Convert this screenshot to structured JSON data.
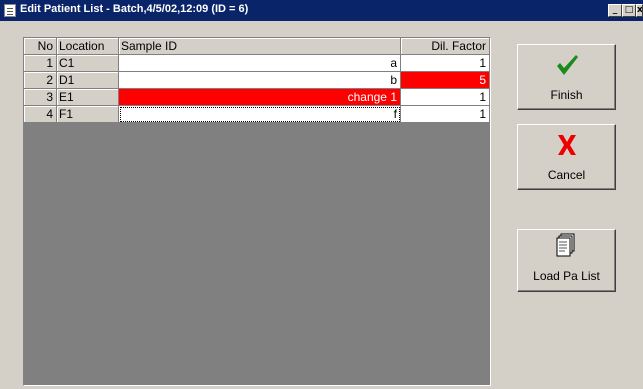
{
  "window": {
    "title": "Edit Patient List - Batch,4/5/02,12:09 (ID = 6)",
    "controls": [
      "_",
      "□",
      "x"
    ]
  },
  "table": {
    "headers": {
      "no": "No",
      "location": "Location",
      "sample_id": "Sample ID",
      "dil_factor": "Dil. Factor"
    },
    "rows": [
      {
        "no": "1",
        "location": "C1",
        "sample_id": "a",
        "dil_factor": "1"
      },
      {
        "no": "2",
        "location": "D1",
        "sample_id": "b",
        "dil_factor": "5"
      },
      {
        "no": "3",
        "location": "E1",
        "sample_id": "change 1",
        "dil_factor": "1"
      },
      {
        "no": "4",
        "location": "F1",
        "sample_id": "f",
        "dil_factor": "1"
      }
    ],
    "highlight_color": "#ff0000"
  },
  "actions": {
    "finish_label": "Finish",
    "cancel_label": "Cancel",
    "load_label": "Load Pa List",
    "finish_icon": "checkmark-icon",
    "cancel_icon": "x-icon",
    "load_icon": "document-icon",
    "finish_color": "#1a8a1a",
    "cancel_color": "#ee0000"
  }
}
